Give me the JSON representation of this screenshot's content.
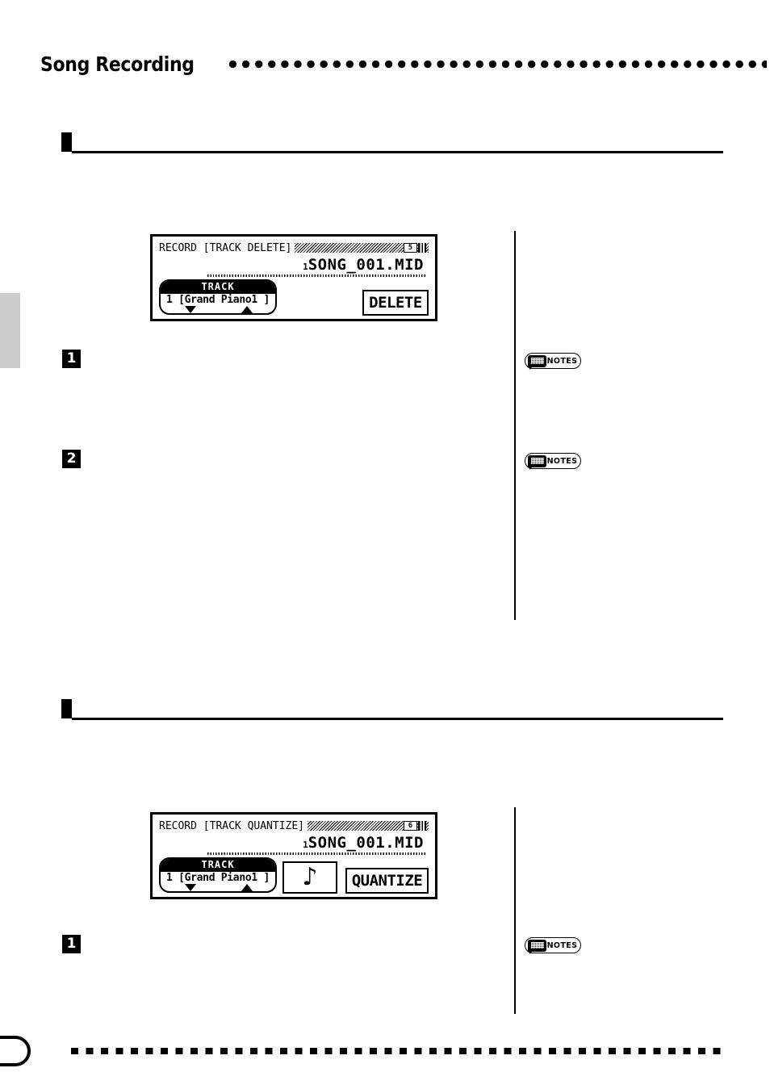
{
  "header": {
    "title": "Song Recording",
    "dots_decoration": "dot-rule"
  },
  "side_tab": {
    "color": "#cccccc"
  },
  "sections": [
    {
      "id": "track-delete",
      "rule": true
    },
    {
      "id": "track-quantize",
      "rule": true
    }
  ],
  "steps": [
    {
      "number": "1"
    },
    {
      "number": "2"
    },
    {
      "number": "1"
    }
  ],
  "notes_badges": [
    {
      "label": "NOTES",
      "icon": "notes-bubble-icon"
    },
    {
      "label": "NOTES",
      "icon": "notes-bubble-icon"
    },
    {
      "label": "NOTES",
      "icon": "notes-bubble-icon"
    }
  ],
  "lcd_screens": [
    {
      "id": "track-delete-screen",
      "title": "RECORD [TRACK DELETE]",
      "page_indicator": "5",
      "song_number": "1",
      "song_name": "SONG_001.MID",
      "track_label": "TRACK",
      "track_value": "1 [Grand Piano1 ]",
      "arrow_down": "down-arrow",
      "arrow_up": "up-arrow",
      "action_label": "DELETE",
      "has_note_box": false,
      "note_glyph": ""
    },
    {
      "id": "track-quantize-screen",
      "title": "RECORD [TRACK QUANTIZE]",
      "page_indicator": "6",
      "song_number": "1",
      "song_name": "SONG_001.MID",
      "track_label": "TRACK",
      "track_value": "1 [Grand Piano1 ]",
      "arrow_down": "down-arrow",
      "arrow_up": "up-arrow",
      "action_label": "QUANTIZE",
      "has_note_box": true,
      "note_glyph": "♪"
    }
  ],
  "footer": {
    "page_tab": "page-number-tab",
    "dots_decoration": "dashed-rule"
  }
}
